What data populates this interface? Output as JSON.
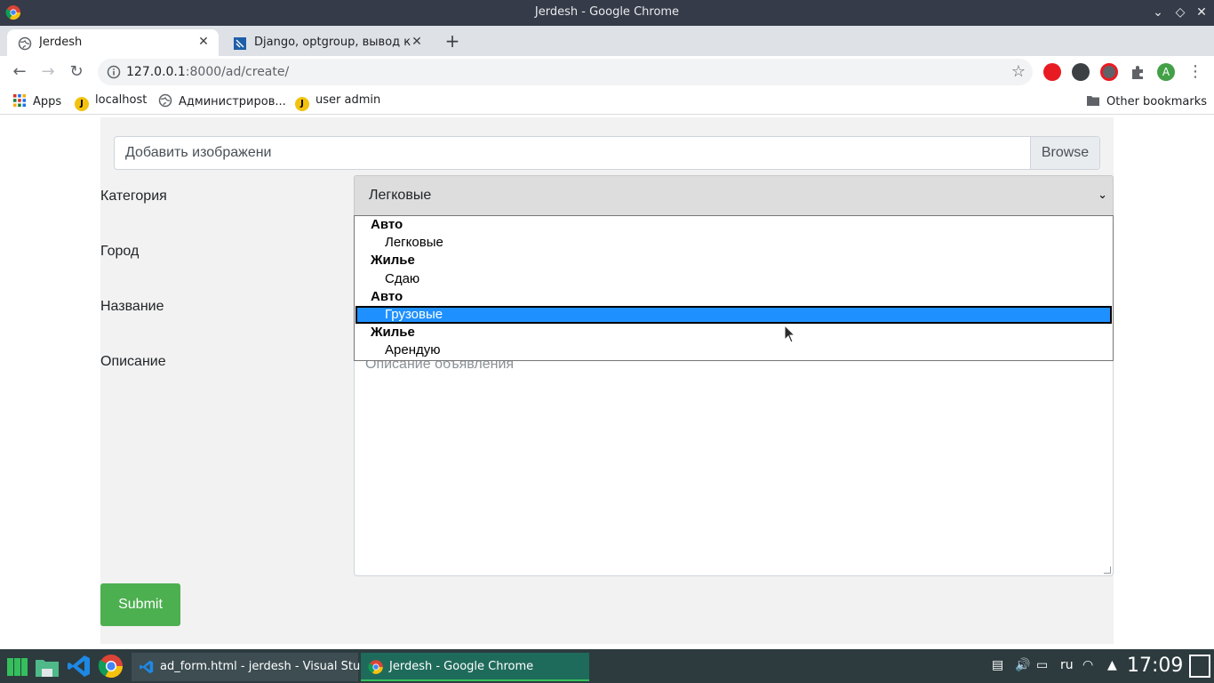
{
  "window": {
    "title": "Jerdesh - Google Chrome"
  },
  "tabs": [
    {
      "label": "Jerdesh",
      "close": "✕"
    },
    {
      "label": "Django, optgroup, вывод кат",
      "close": "✕"
    }
  ],
  "new_tab": "+",
  "toolbar": {
    "url_host": "127.0.0.1",
    "url_rest": ":8000/ad/create/"
  },
  "bookmarks": {
    "items": [
      "Apps",
      "localhost",
      "Администриров...",
      "user admin"
    ],
    "other": "Other bookmarks",
    "j_letter": "J"
  },
  "form": {
    "file_placeholder": "Добавить изображени",
    "browse_label": "Browse",
    "category_label": "Категория",
    "category_value": "Легковые",
    "city_label": "Город",
    "name_label": "Название",
    "description_label": "Описание",
    "description_placeholder": "Описание объявления",
    "submit_label": "Submit"
  },
  "dropdown": {
    "rows": [
      {
        "type": "group",
        "text": "Авто"
      },
      {
        "type": "option",
        "text": "Легковые"
      },
      {
        "type": "group",
        "text": "Жилье"
      },
      {
        "type": "option",
        "text": "Сдаю"
      },
      {
        "type": "group",
        "text": "Авто"
      },
      {
        "type": "option",
        "text": "Грузовые",
        "selected": true
      },
      {
        "type": "group",
        "text": "Жилье"
      },
      {
        "type": "option",
        "text": "Арендую"
      }
    ]
  },
  "taskbar": {
    "tasks": [
      "ad_form.html - jerdesh - Visual Stu...",
      "Jerdesh - Google Chrome"
    ],
    "lang": "ru",
    "clock": "17:09"
  },
  "colors": {
    "submit": "#4caf50",
    "selected_option": "#1e90ff",
    "taskbar": "#2d3b3f"
  }
}
